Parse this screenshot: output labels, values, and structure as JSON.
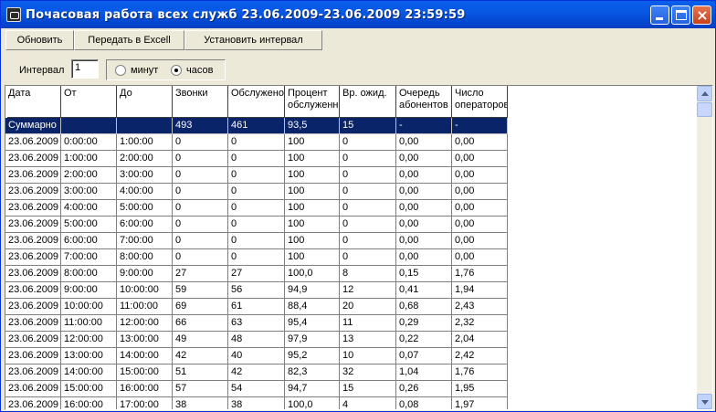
{
  "window": {
    "title": "Почасовая работа всех служб   23.06.2009-23.06.2009 23:59:59",
    "min_glyph": "",
    "close_glyph": "×"
  },
  "toolbar": {
    "refresh_label": "Обновить",
    "export_label": "Передать в Excell",
    "interval_label": "Установить интервал"
  },
  "options": {
    "interval_label": "Интервал",
    "interval_value": "1",
    "radio_minutes": "минут",
    "radio_hours": "часов",
    "selected": "hours"
  },
  "table": {
    "columns": [
      "Дата",
      "От",
      "До",
      "Звонки",
      "Обслужено",
      "Процент\nобслуженн",
      "Вр. ожид.",
      "Очередь\nабонентов",
      "Число\nоператоров"
    ],
    "rows": [
      [
        "Суммарно",
        "",
        "",
        "493",
        "461",
        "93,5",
        "15",
        "-",
        "-"
      ],
      [
        "23.06.2009",
        "0:00:00",
        "1:00:00",
        "0",
        "0",
        "100",
        "0",
        "0,00",
        "0,00"
      ],
      [
        "23.06.2009",
        "1:00:00",
        "2:00:00",
        "0",
        "0",
        "100",
        "0",
        "0,00",
        "0,00"
      ],
      [
        "23.06.2009",
        "2:00:00",
        "3:00:00",
        "0",
        "0",
        "100",
        "0",
        "0,00",
        "0,00"
      ],
      [
        "23.06.2009",
        "3:00:00",
        "4:00:00",
        "0",
        "0",
        "100",
        "0",
        "0,00",
        "0,00"
      ],
      [
        "23.06.2009",
        "4:00:00",
        "5:00:00",
        "0",
        "0",
        "100",
        "0",
        "0,00",
        "0,00"
      ],
      [
        "23.06.2009",
        "5:00:00",
        "6:00:00",
        "0",
        "0",
        "100",
        "0",
        "0,00",
        "0,00"
      ],
      [
        "23.06.2009",
        "6:00:00",
        "7:00:00",
        "0",
        "0",
        "100",
        "0",
        "0,00",
        "0,00"
      ],
      [
        "23.06.2009",
        "7:00:00",
        "8:00:00",
        "0",
        "0",
        "100",
        "0",
        "0,00",
        "0,00"
      ],
      [
        "23.06.2009",
        "8:00:00",
        "9:00:00",
        "27",
        "27",
        "100,0",
        "8",
        "0,15",
        "1,76"
      ],
      [
        "23.06.2009",
        "9:00:00",
        "10:00:00",
        "59",
        "56",
        "94,9",
        "12",
        "0,41",
        "1,94"
      ],
      [
        "23.06.2009",
        "10:00:00",
        "11:00:00",
        "69",
        "61",
        "88,4",
        "20",
        "0,68",
        "2,43"
      ],
      [
        "23.06.2009",
        "11:00:00",
        "12:00:00",
        "66",
        "63",
        "95,4",
        "11",
        "0,29",
        "2,32"
      ],
      [
        "23.06.2009",
        "12:00:00",
        "13:00:00",
        "49",
        "48",
        "97,9",
        "13",
        "0,22",
        "2,04"
      ],
      [
        "23.06.2009",
        "13:00:00",
        "14:00:00",
        "42",
        "40",
        "95,2",
        "10",
        "0,07",
        "2,42"
      ],
      [
        "23.06.2009",
        "14:00:00",
        "15:00:00",
        "51",
        "42",
        "82,3",
        "32",
        "1,04",
        "1,76"
      ],
      [
        "23.06.2009",
        "15:00:00",
        "16:00:00",
        "57",
        "54",
        "94,7",
        "15",
        "0,26",
        "1,95"
      ],
      [
        "23.06.2009",
        "16:00:00",
        "17:00:00",
        "38",
        "38",
        "100,0",
        "4",
        "0,08",
        "1,97"
      ]
    ],
    "selected_row": 0
  }
}
